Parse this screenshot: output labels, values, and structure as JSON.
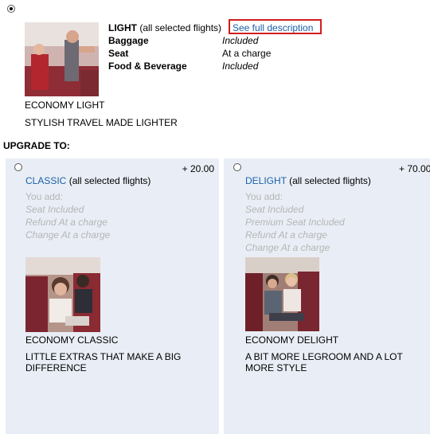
{
  "current": {
    "fare": "LIGHT",
    "scope": "(all selected flights)",
    "link": "See full description",
    "rows": [
      {
        "label": "Baggage",
        "value": "Included"
      },
      {
        "label": "Seat",
        "value": "At a charge"
      },
      {
        "label": "Food & Beverage",
        "value": "Included"
      }
    ],
    "caption_title": "ECONOMY LIGHT",
    "caption_tagline": "STYLISH TRAVEL MADE LIGHTER"
  },
  "upgrade_heading": "UPGRADE TO:",
  "options": [
    {
      "price": "+ 20.00",
      "name": "CLASSIC",
      "scope": "(all selected flights)",
      "you_add": "You add:",
      "features": [
        "Seat Included",
        "Refund At a charge",
        "Change At a charge"
      ],
      "caption_title": "ECONOMY CLASSIC",
      "caption_tagline": "LITTLE EXTRAS THAT MAKE A BIG DIFFERENCE"
    },
    {
      "price": "+ 70.00",
      "name": "DELIGHT",
      "scope": "(all selected flights)",
      "you_add": "You add:",
      "features": [
        "Seat Included",
        "Premium Seat Included",
        "Refund At a charge",
        "Change At a charge"
      ],
      "caption_title": "ECONOMY DELIGHT",
      "caption_tagline": "A BIT MORE LEGROOM AND A LOT MORE STYLE"
    }
  ]
}
